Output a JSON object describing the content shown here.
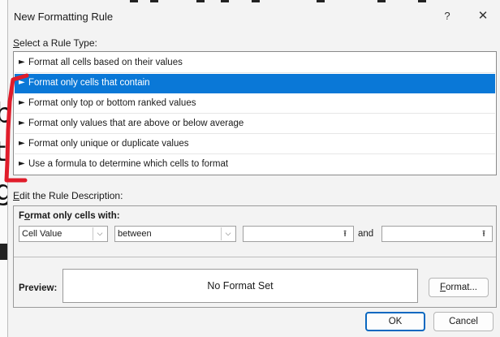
{
  "window": {
    "title": "New Formatting Rule",
    "help": "?",
    "close": "✕"
  },
  "rule_type": {
    "label_accel": "S",
    "label_rest": "elect a Rule Type:",
    "items": [
      {
        "label": "Format all cells based on their values",
        "selected": false
      },
      {
        "label": "Format only cells that contain",
        "selected": true
      },
      {
        "label": "Format only top or bottom ranked values",
        "selected": false
      },
      {
        "label": "Format only values that are above or below average",
        "selected": false
      },
      {
        "label": "Format only unique or duplicate values",
        "selected": false
      },
      {
        "label": "Use a formula to determine which cells to format",
        "selected": false
      }
    ],
    "arrow_glyph": "►"
  },
  "description": {
    "label_accel": "E",
    "label_rest": "dit the Rule Description:",
    "format_with_accel": "o",
    "format_with_pre": "F",
    "format_with_post": "rmat only cells with:",
    "condition_type": "Cell Value",
    "operator": "between",
    "value1": "",
    "and_label": "and",
    "value2": "",
    "dropdown_glyph": "⌵",
    "ref_glyph": "⭱"
  },
  "preview": {
    "label": "Preview:",
    "text": "No Format Set",
    "format_button_accel": "F",
    "format_button_rest": "ormat..."
  },
  "buttons": {
    "ok": "OK",
    "cancel": "Cancel"
  },
  "background_glyphs": [
    "b",
    "t",
    "g"
  ],
  "colors": {
    "selection": "#0a78d7",
    "annotation": "#e01c2a",
    "primary_border": "#0a68c0"
  }
}
